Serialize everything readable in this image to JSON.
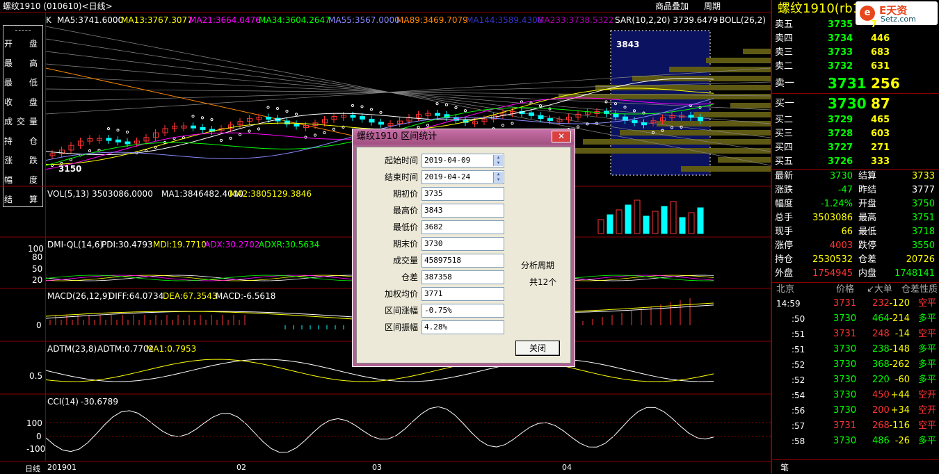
{
  "title_bar": {
    "left": "螺纹1910 (010610)<日线>",
    "overlay": "商品叠加",
    "period": "周期"
  },
  "indicators": {
    "main": {
      "k": "K",
      "ma5": "MA5:3741.6000",
      "ma13": "MA13:3767.3077",
      "ma21": "MA21:3664.0476",
      "ma34": "MA34:3604.2647",
      "ma55": "MA55:3567.0000",
      "ma89": "MA89:3469.7079",
      "ma144": "MA144:3589.4306",
      "ma233": "MA233:3738.5322",
      "sar": "SAR(10,2,20) 3739.6479",
      "boll": "BOLL(26,2)"
    },
    "vol": {
      "label": "VOL(5,13) 3503086.0000",
      "ma1": "MA1:3846482.4000",
      "ma2": "MA2:3805129.3846"
    },
    "dmi": {
      "label": "DMI-QL(14,6)",
      "pdi": "PDI:30.4793",
      "mdi": "MDI:19.7710",
      "adx": "ADX:30.2702",
      "adxr": "ADXR:30.5634",
      "ticks": [
        "100",
        "80",
        "50",
        "20"
      ]
    },
    "macd": {
      "label": "MACD(26,12,9)",
      "diff": "DIFF:64.0734",
      "dea": "DEA:67.3543",
      "macd": "MACD:-6.5618",
      "tick": "0"
    },
    "adtm": {
      "label": "ADTM(23,8)",
      "adtm": "ADTM:0.7702",
      "ma1": "MA1:0.7953",
      "tick": "0.5"
    },
    "cci": {
      "label": "CCI(14)",
      "value": "-30.6789",
      "ticks": [
        "100",
        "0",
        "-100"
      ]
    }
  },
  "price_marks": {
    "high": "3843",
    "low": "3150"
  },
  "left_menu": [
    "开　盘",
    "最　高",
    "最　低",
    "收　盘",
    "成交量",
    "持　仓",
    "涨　跌",
    "幅　度",
    "结　算"
  ],
  "bottom": {
    "period": "日线",
    "dates": [
      "201901",
      "02",
      "03",
      "04"
    ]
  },
  "dialog": {
    "title": "螺纹1910 区间统计",
    "close_x": "✕",
    "fields": [
      {
        "label": "起始时间",
        "value": "2019-04-09",
        "spin": true
      },
      {
        "label": "结束时间",
        "value": "2019-04-24",
        "spin": true
      },
      {
        "label": "期初价",
        "value": "3735"
      },
      {
        "label": "最高价",
        "value": "3843"
      },
      {
        "label": "最低价",
        "value": "3682"
      },
      {
        "label": "期末价",
        "value": "3730"
      },
      {
        "label": "成交量",
        "value": "45897518"
      },
      {
        "label": "仓差",
        "value": "387358"
      },
      {
        "label": "加权均价",
        "value": "3771"
      },
      {
        "label": "区间涨幅",
        "value": "-0.75%"
      },
      {
        "label": "区间振幅",
        "value": "4.28%"
      }
    ],
    "side1": "分析周期",
    "side2": "共12个",
    "close_btn": "关闭"
  },
  "right_panel": {
    "title": "螺纹1910(rb1910)",
    "logo": {
      "mark": "e",
      "brand": "E天资",
      "site": "Setz.com"
    },
    "asks": [
      {
        "label": "卖五",
        "price": "3735",
        "vol": "7"
      },
      {
        "label": "卖四",
        "price": "3734",
        "vol": "446"
      },
      {
        "label": "卖三",
        "price": "3733",
        "vol": "683"
      },
      {
        "label": "卖二",
        "price": "3732",
        "vol": "631"
      },
      {
        "label": "卖一",
        "price": "3731",
        "vol": "256"
      }
    ],
    "bids": [
      {
        "label": "买一",
        "price": "3730",
        "vol": "87"
      },
      {
        "label": "买二",
        "price": "3729",
        "vol": "465"
      },
      {
        "label": "买三",
        "price": "3728",
        "vol": "603"
      },
      {
        "label": "买四",
        "price": "3727",
        "vol": "271"
      },
      {
        "label": "买五",
        "price": "3726",
        "vol": "333"
      }
    ],
    "stats": [
      {
        "l1": "最新",
        "v1": "3730",
        "l2": "结算",
        "v2": "3733"
      },
      {
        "l1": "涨跌",
        "v1": "-47",
        "l2": "昨结",
        "v2": "3777"
      },
      {
        "l1": "幅度",
        "v1": "-1.24%",
        "l2": "开盘",
        "v2": "3750"
      },
      {
        "l1": "总手",
        "v1": "3503086",
        "l2": "最高",
        "v2": "3751"
      },
      {
        "l1": "现手",
        "v1": "66",
        "l2": "最低",
        "v2": "3718"
      },
      {
        "l1": "涨停",
        "v1": "4003",
        "l2": "跌停",
        "v2": "3550"
      },
      {
        "l1": "持仓",
        "v1": "2530532",
        "l2": "仓差",
        "v2": "20726"
      },
      {
        "l1": "外盘",
        "v1": "1754945",
        "l2": "内盘",
        "v2": "1748141"
      }
    ],
    "tick_header": {
      "loc": "北京",
      "price": "价格",
      "big": "↙大单",
      "oi": "仓差",
      "nature": "性质"
    },
    "ticks": [
      {
        "time": "14:59",
        "price": "3731",
        "vol": "232",
        "oi": "-120",
        "nature": "空平"
      },
      {
        "time": ":50",
        "price": "3730",
        "vol": "464",
        "oi": "-214",
        "nature": "多平"
      },
      {
        "time": ":51",
        "price": "3731",
        "vol": "248",
        "oi": "-14",
        "nature": "空平"
      },
      {
        "time": ":51",
        "price": "3730",
        "vol": "238",
        "oi": "-148",
        "nature": "多平"
      },
      {
        "time": ":52",
        "price": "3730",
        "vol": "368",
        "oi": "-262",
        "nature": "多平"
      },
      {
        "time": ":52",
        "price": "3730",
        "vol": "220",
        "oi": "-60",
        "nature": "多平"
      },
      {
        "time": ":54",
        "price": "3730",
        "vol": "450",
        "oi": "+44",
        "nature": "空开"
      },
      {
        "time": ":56",
        "price": "3730",
        "vol": "200",
        "oi": "+34",
        "nature": "空开"
      },
      {
        "time": ":57",
        "price": "3731",
        "vol": "268",
        "oi": "-116",
        "nature": "空平"
      },
      {
        "time": ":58",
        "price": "3730",
        "vol": "486",
        "oi": "-26",
        "nature": "多平"
      }
    ],
    "bottom_tab": "笔"
  }
}
